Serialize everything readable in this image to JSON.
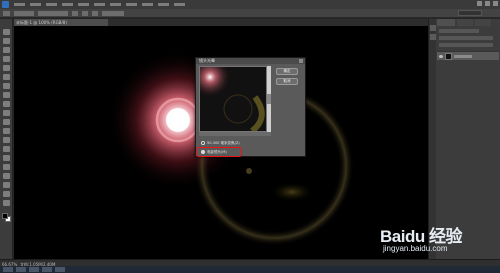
{
  "menubar": {
    "menu_count": 11
  },
  "document_tab": {
    "label": "未标题-1 @ 100% (RGB/8)"
  },
  "status": {
    "zoom": "66.67%",
    "doc_size": "文档:1.05M/2.40M"
  },
  "dialog": {
    "title": "镜头光晕",
    "ok_label": "确定",
    "cancel_label": "取消",
    "option_1": "50-300 毫米变焦(Z)",
    "option_2": "电影镜头(M)"
  },
  "watermark": {
    "brand": "Baidu 经验",
    "sub": "jingyan.baidu.com"
  },
  "colors": {
    "canvas": "#000000",
    "highlight": "#e11111",
    "ui_dark": "#3c3c3c"
  },
  "icons": [
    "photoshop-logo-icon",
    "move-tool-icon",
    "marquee-tool-icon",
    "lasso-tool-icon",
    "brush-tool-icon",
    "eye-icon",
    "close-icon"
  ]
}
